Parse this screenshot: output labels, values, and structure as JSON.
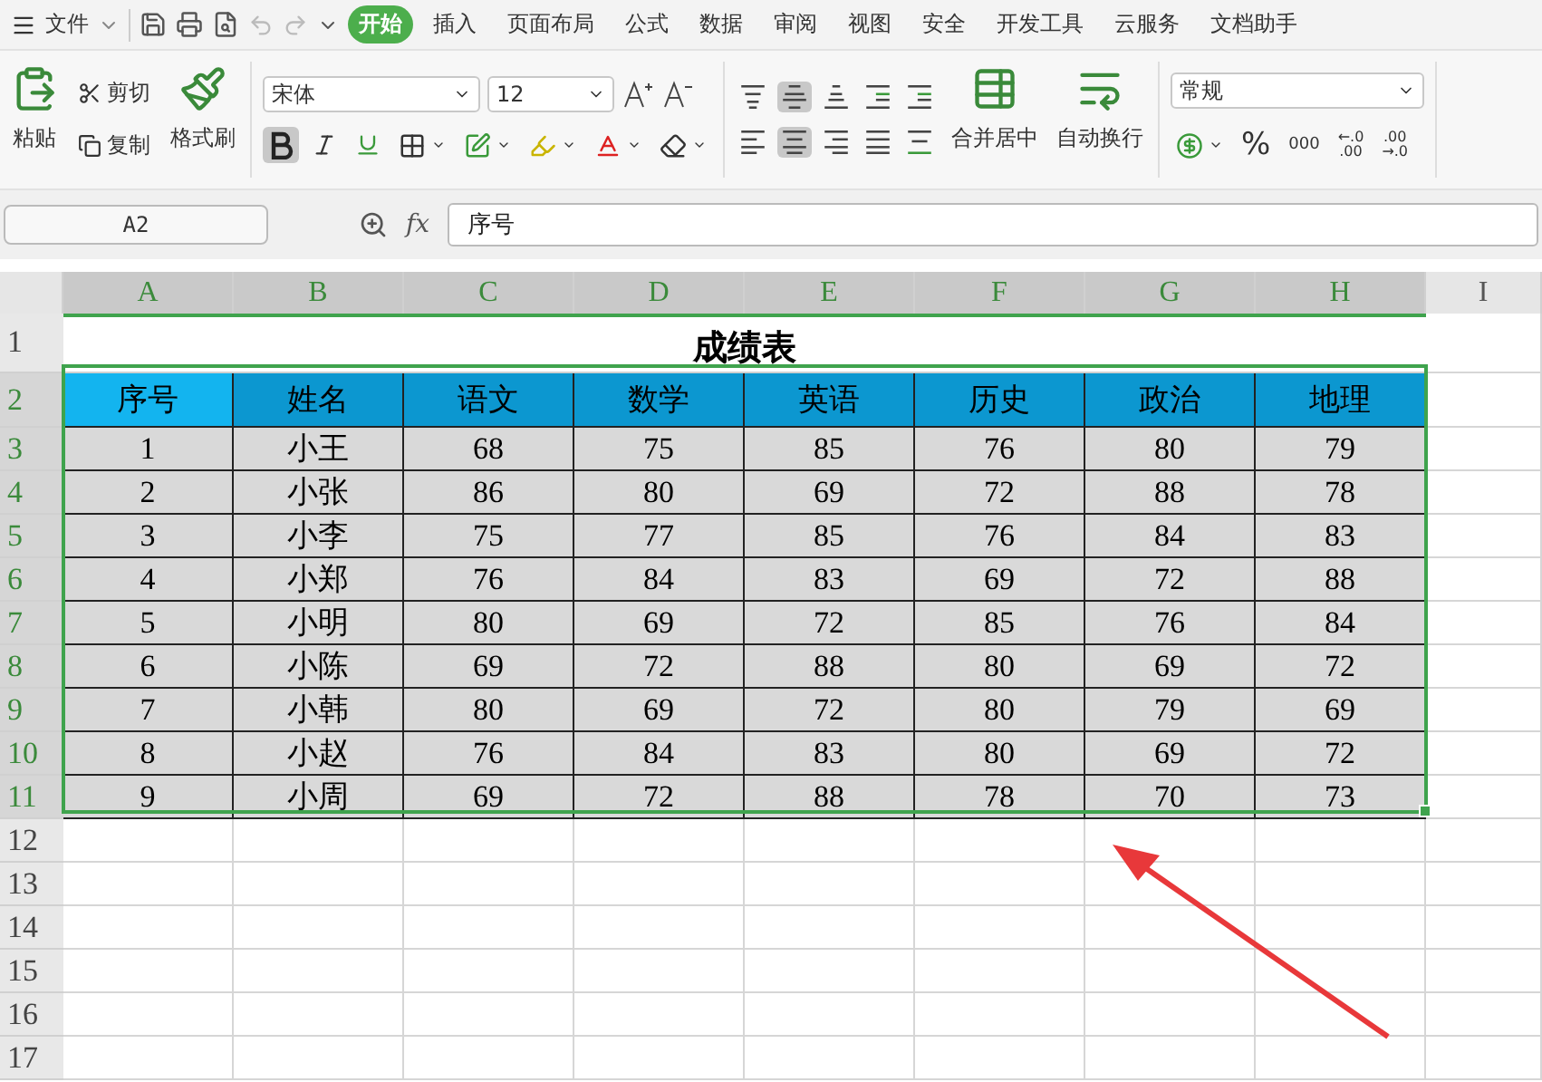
{
  "menu": {
    "file_label": "文件",
    "tabs": [
      {
        "label": "开始",
        "selected": true
      },
      {
        "label": "插入",
        "selected": false
      },
      {
        "label": "页面布局",
        "selected": false
      },
      {
        "label": "公式",
        "selected": false
      },
      {
        "label": "数据",
        "selected": false
      },
      {
        "label": "审阅",
        "selected": false
      },
      {
        "label": "视图",
        "selected": false
      },
      {
        "label": "安全",
        "selected": false
      },
      {
        "label": "开发工具",
        "selected": false
      },
      {
        "label": "云服务",
        "selected": false
      },
      {
        "label": "文档助手",
        "selected": false
      }
    ]
  },
  "ribbon": {
    "paste": "粘贴",
    "cut": "剪切",
    "copy": "复制",
    "format_painter": "格式刷",
    "font_name": "宋体",
    "font_size": "12",
    "bold": {
      "pressed": true
    },
    "italic": {
      "pressed": false
    },
    "underline": {
      "pressed": false
    },
    "align_top": [
      {
        "kind": "top",
        "pressed": false
      },
      {
        "kind": "middle",
        "pressed": true
      },
      {
        "kind": "bottom",
        "pressed": false
      },
      {
        "kind": "outdent",
        "pressed": false
      },
      {
        "kind": "indent",
        "pressed": false
      }
    ],
    "align_bottom": [
      {
        "kind": "left",
        "pressed": false
      },
      {
        "kind": "center",
        "pressed": true
      },
      {
        "kind": "right",
        "pressed": false
      },
      {
        "kind": "justify",
        "pressed": false
      },
      {
        "kind": "distribute",
        "pressed": false
      }
    ],
    "merge": "合并居中",
    "wrap": "自动换行",
    "number_format": "常规",
    "percent": "%",
    "thousands": "000",
    "decimal_increase": [
      "←.0",
      ".00"
    ],
    "decimal_decrease": [
      ".00",
      "→.0"
    ]
  },
  "formula_bar": {
    "cell_ref": "A2",
    "fx": "fx",
    "formula": "序号"
  },
  "sheet": {
    "columns": [
      {
        "label": "A",
        "selected": true
      },
      {
        "label": "B",
        "selected": true
      },
      {
        "label": "C",
        "selected": true
      },
      {
        "label": "D",
        "selected": true
      },
      {
        "label": "E",
        "selected": true
      },
      {
        "label": "F",
        "selected": true
      },
      {
        "label": "G",
        "selected": true
      },
      {
        "label": "H",
        "selected": true
      },
      {
        "label": "I",
        "selected": false
      }
    ],
    "title_row": {
      "number": "1",
      "title": "成绩表",
      "selected": false
    },
    "header_row": {
      "number": "2",
      "selected": true,
      "cells": [
        {
          "text": "序号",
          "active": true
        },
        {
          "text": "姓名",
          "active": false
        },
        {
          "text": "语文",
          "active": false
        },
        {
          "text": "数学",
          "active": false
        },
        {
          "text": "英语",
          "active": false
        },
        {
          "text": "历史",
          "active": false
        },
        {
          "text": "政治",
          "active": false
        },
        {
          "text": "地理",
          "active": false
        }
      ]
    },
    "rows": [
      {
        "number": "3",
        "selected": true,
        "cells": [
          "1",
          "小王",
          "68",
          "75",
          "85",
          "76",
          "80",
          "79"
        ]
      },
      {
        "number": "4",
        "selected": true,
        "cells": [
          "2",
          "小张",
          "86",
          "80",
          "69",
          "72",
          "88",
          "78"
        ]
      },
      {
        "number": "5",
        "selected": true,
        "cells": [
          "3",
          "小李",
          "75",
          "77",
          "85",
          "76",
          "84",
          "83"
        ]
      },
      {
        "number": "6",
        "selected": true,
        "cells": [
          "4",
          "小郑",
          "76",
          "84",
          "83",
          "69",
          "72",
          "88"
        ]
      },
      {
        "number": "7",
        "selected": true,
        "cells": [
          "5",
          "小明",
          "80",
          "69",
          "72",
          "85",
          "76",
          "84"
        ]
      },
      {
        "number": "8",
        "selected": true,
        "cells": [
          "6",
          "小陈",
          "69",
          "72",
          "88",
          "80",
          "69",
          "72"
        ]
      },
      {
        "number": "9",
        "selected": true,
        "cells": [
          "7",
          "小韩",
          "80",
          "69",
          "72",
          "80",
          "79",
          "69"
        ]
      },
      {
        "number": "10",
        "selected": true,
        "cells": [
          "8",
          "小赵",
          "76",
          "84",
          "83",
          "80",
          "69",
          "72"
        ]
      },
      {
        "number": "11",
        "selected": true,
        "cells": [
          "9",
          "小周",
          "69",
          "72",
          "88",
          "78",
          "70",
          "73"
        ]
      }
    ],
    "empty_rows": [
      {
        "number": "12",
        "selected": false
      },
      {
        "number": "13",
        "selected": false
      },
      {
        "number": "14",
        "selected": false
      },
      {
        "number": "15",
        "selected": false
      },
      {
        "number": "16",
        "selected": false
      },
      {
        "number": "17",
        "selected": false
      }
    ]
  }
}
